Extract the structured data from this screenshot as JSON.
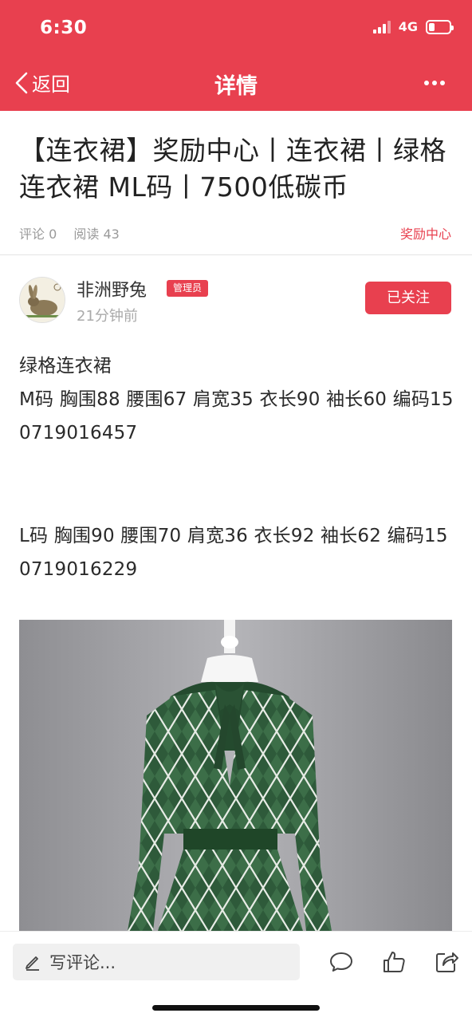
{
  "status_bar": {
    "time": "6:30",
    "network": "4G"
  },
  "nav": {
    "back_label": "返回",
    "title": "详情"
  },
  "article": {
    "title": "【连衣裙】奖励中心丨连衣裙丨绿格连衣裙 ML码丨7500低碳币",
    "comments": "评论 0",
    "reads": "阅读 43",
    "category": "奖励中心"
  },
  "author": {
    "name": "非洲野兔",
    "badge": "管理员",
    "time": "21分钟前",
    "follow_label": "已关注"
  },
  "content": {
    "paragraph1": "绿格连衣裙\nM码  胸围88  腰围67  肩宽35  衣长90  袖长60  编码150719016457",
    "paragraph2": "L码  胸围90  腰围70  肩宽36  衣长92  袖长62  编码150719016229"
  },
  "bottom_bar": {
    "comment_placeholder": "写评论..."
  },
  "colors": {
    "accent": "#e8404f",
    "dress_green": "#2e5a3a"
  },
  "icons": [
    "chevron-left-icon",
    "more-icon",
    "edit-icon",
    "comment-icon",
    "thumbs-up-icon",
    "share-icon"
  ]
}
